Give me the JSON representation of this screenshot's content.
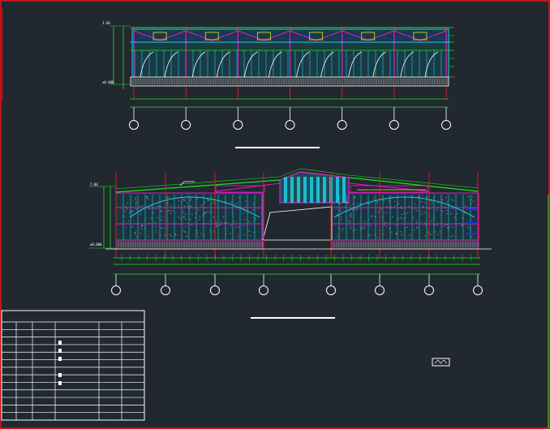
{
  "colors": {
    "background": "#212830",
    "frame": "#c0141c",
    "structure_green": "#19e619",
    "roof_magenta": "#e619c8",
    "glass_cyan": "#19d2e6",
    "axis_red": "#e61919",
    "blue": "#1432e6",
    "yellow": "#e6e619",
    "white": "#ffffff"
  },
  "elevation_top": {
    "level_top": "3.60",
    "level_base": "±0.000",
    "axis_count": 7
  },
  "elevation_bottom": {
    "level_top": "7.00",
    "level_base": "±0.000",
    "axis_count": 8
  },
  "title_table": {
    "rows": 13,
    "cols": 6
  }
}
